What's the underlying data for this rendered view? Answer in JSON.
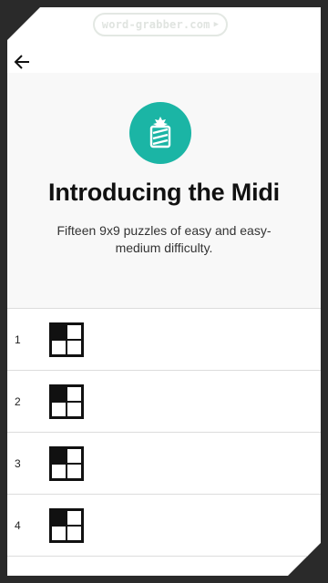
{
  "watermark": {
    "text": "word-grabber.com",
    "arrow": "▶"
  },
  "header": {
    "back_icon": "arrow-left-icon"
  },
  "hero": {
    "badge_icon": "gift-midi-icon",
    "badge_color": "#1bb5a5",
    "title": "Introducing the Midi",
    "subtitle": "Fifteen 9x9 puzzles of easy and easy-medium difficulty."
  },
  "puzzles": [
    {
      "number": "1",
      "icon": "crossword-grid-icon"
    },
    {
      "number": "2",
      "icon": "crossword-grid-icon"
    },
    {
      "number": "3",
      "icon": "crossword-grid-icon"
    },
    {
      "number": "4",
      "icon": "crossword-grid-icon"
    }
  ]
}
